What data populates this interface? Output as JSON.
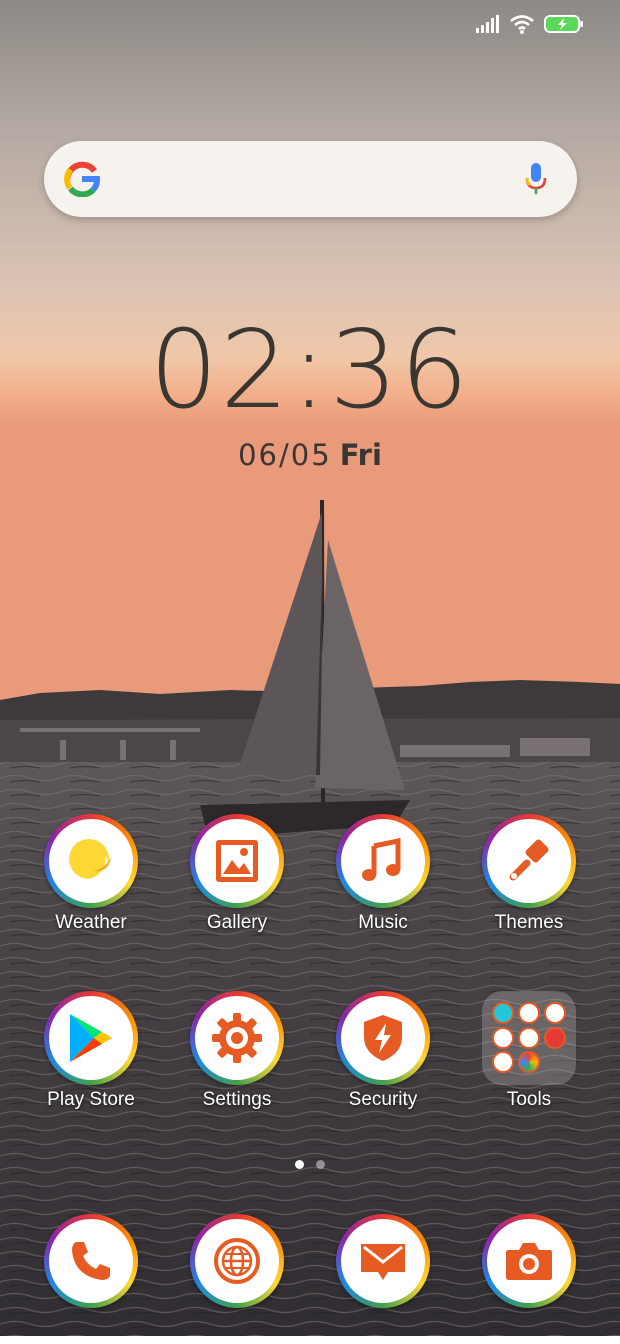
{
  "status_bar": {
    "icons": [
      "signal-icon",
      "wifi-icon",
      "battery-charging-icon"
    ]
  },
  "search_bar": {
    "logo": "google-g-icon",
    "mic": "microphone-icon"
  },
  "clock": {
    "time": "02:36",
    "date": "06/05",
    "weekday": "Fri"
  },
  "apps": [
    {
      "label": "Weather",
      "icon": "weather-icon"
    },
    {
      "label": "Gallery",
      "icon": "gallery-icon"
    },
    {
      "label": "Music",
      "icon": "music-icon"
    },
    {
      "label": "Themes",
      "icon": "brush-icon"
    },
    {
      "label": "Play Store",
      "icon": "play-store-icon"
    },
    {
      "label": "Settings",
      "icon": "gear-icon"
    },
    {
      "label": "Security",
      "icon": "shield-icon"
    },
    {
      "label": "Tools",
      "icon": "folder-icon"
    }
  ],
  "page_indicator": {
    "pages": 2,
    "current": 1
  },
  "dock": [
    {
      "icon": "phone-icon"
    },
    {
      "icon": "browser-icon"
    },
    {
      "icon": "messaging-icon"
    },
    {
      "icon": "camera-icon"
    }
  ],
  "colors": {
    "accent": "#e65a24",
    "text_dark": "#3a3632",
    "label_white": "#ffffff"
  }
}
